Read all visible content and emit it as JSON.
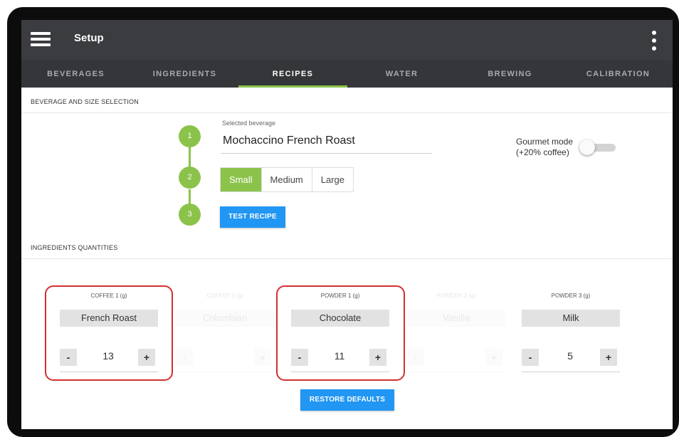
{
  "app": {
    "title": "Setup"
  },
  "tabs": [
    {
      "label": "BEVERAGES"
    },
    {
      "label": "INGREDIENTS"
    },
    {
      "label": "RECIPES"
    },
    {
      "label": "WATER"
    },
    {
      "label": "BREWING"
    },
    {
      "label": "CALIBRATION"
    }
  ],
  "active_tab": "RECIPES",
  "beverage_section": {
    "header": "BEVERAGE AND SIZE SELECTION",
    "steps": [
      "1",
      "2",
      "3"
    ],
    "selected_beverage_label": "Selected beverage",
    "selected_beverage_value": "Mochaccino French Roast",
    "gourmet_line1": "Gourmet mode",
    "gourmet_line2": "(+20% coffee)",
    "gourmet_enabled": false,
    "sizes": [
      "Small",
      "Medium",
      "Large"
    ],
    "selected_size": "Small",
    "test_button": "TEST RECIPE"
  },
  "ingredients_section": {
    "header": "INGREDIENTS QUANTITIES",
    "minus_label": "-",
    "plus_label": "+",
    "columns": [
      {
        "label": "COFFEE 1 (g)",
        "name": "French Roast",
        "value": "13",
        "enabled": true
      },
      {
        "label": "COFFEE 2 (g)",
        "name": "Colombian",
        "value": "",
        "enabled": false
      },
      {
        "label": "POWDER 1 (g)",
        "name": "Chocolate",
        "value": "11",
        "enabled": true
      },
      {
        "label": "POWDER 2 (g)",
        "name": "Vanilla",
        "value": "",
        "enabled": false
      },
      {
        "label": "POWDER 3 (g)",
        "name": "Milk",
        "value": "5",
        "enabled": true
      }
    ],
    "restore_button": "RESTORE DEFAULTS"
  },
  "colors": {
    "accent_green": "#8bc34a",
    "button_blue": "#2196f3",
    "appbar": "#3b3c40",
    "highlight_red": "#d32f2f"
  },
  "icons": {
    "menu": "hamburger-menu-icon",
    "overflow": "more-vert-icon"
  }
}
